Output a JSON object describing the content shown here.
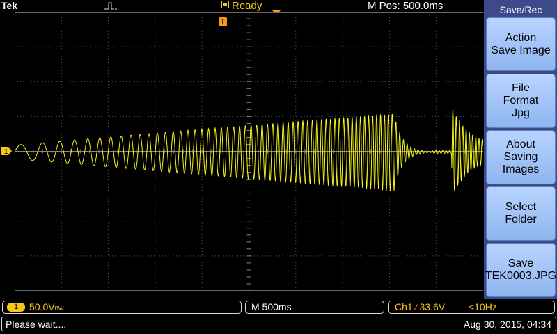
{
  "header": {
    "brand": "Tek",
    "status": "Ready",
    "mpos": "M Pos: 500.0ms"
  },
  "markers": {
    "trigger_label": "T",
    "channel_label": "1"
  },
  "menu": {
    "title": "Save/Rec",
    "buttons": [
      {
        "line1": "Action",
        "line2": "Save Image",
        "line3": ""
      },
      {
        "line1": "File",
        "line2": "Format",
        "line3": "Jpg"
      },
      {
        "line1": "About",
        "line2": "Saving",
        "line3": "Images"
      },
      {
        "line1": "Select",
        "line2": "Folder",
        "line3": ""
      },
      {
        "line1": "Save",
        "line2": "TEK0003.JPG",
        "line3": ""
      }
    ]
  },
  "footer": {
    "ch_badge": "1",
    "ch_scale": "50.0V",
    "ch_bw": "BW",
    "timebase": "M 500ms",
    "trigger_source": "Ch1",
    "trigger_level": "33.6V",
    "trigger_freq": "<10Hz",
    "message": "Please wait....",
    "datetime": "Aug 30, 2015, 04:34"
  },
  "colors": {
    "trace": "#f5f518",
    "sidebar": "#3c4a8c",
    "trigger": "#f39c12"
  }
}
